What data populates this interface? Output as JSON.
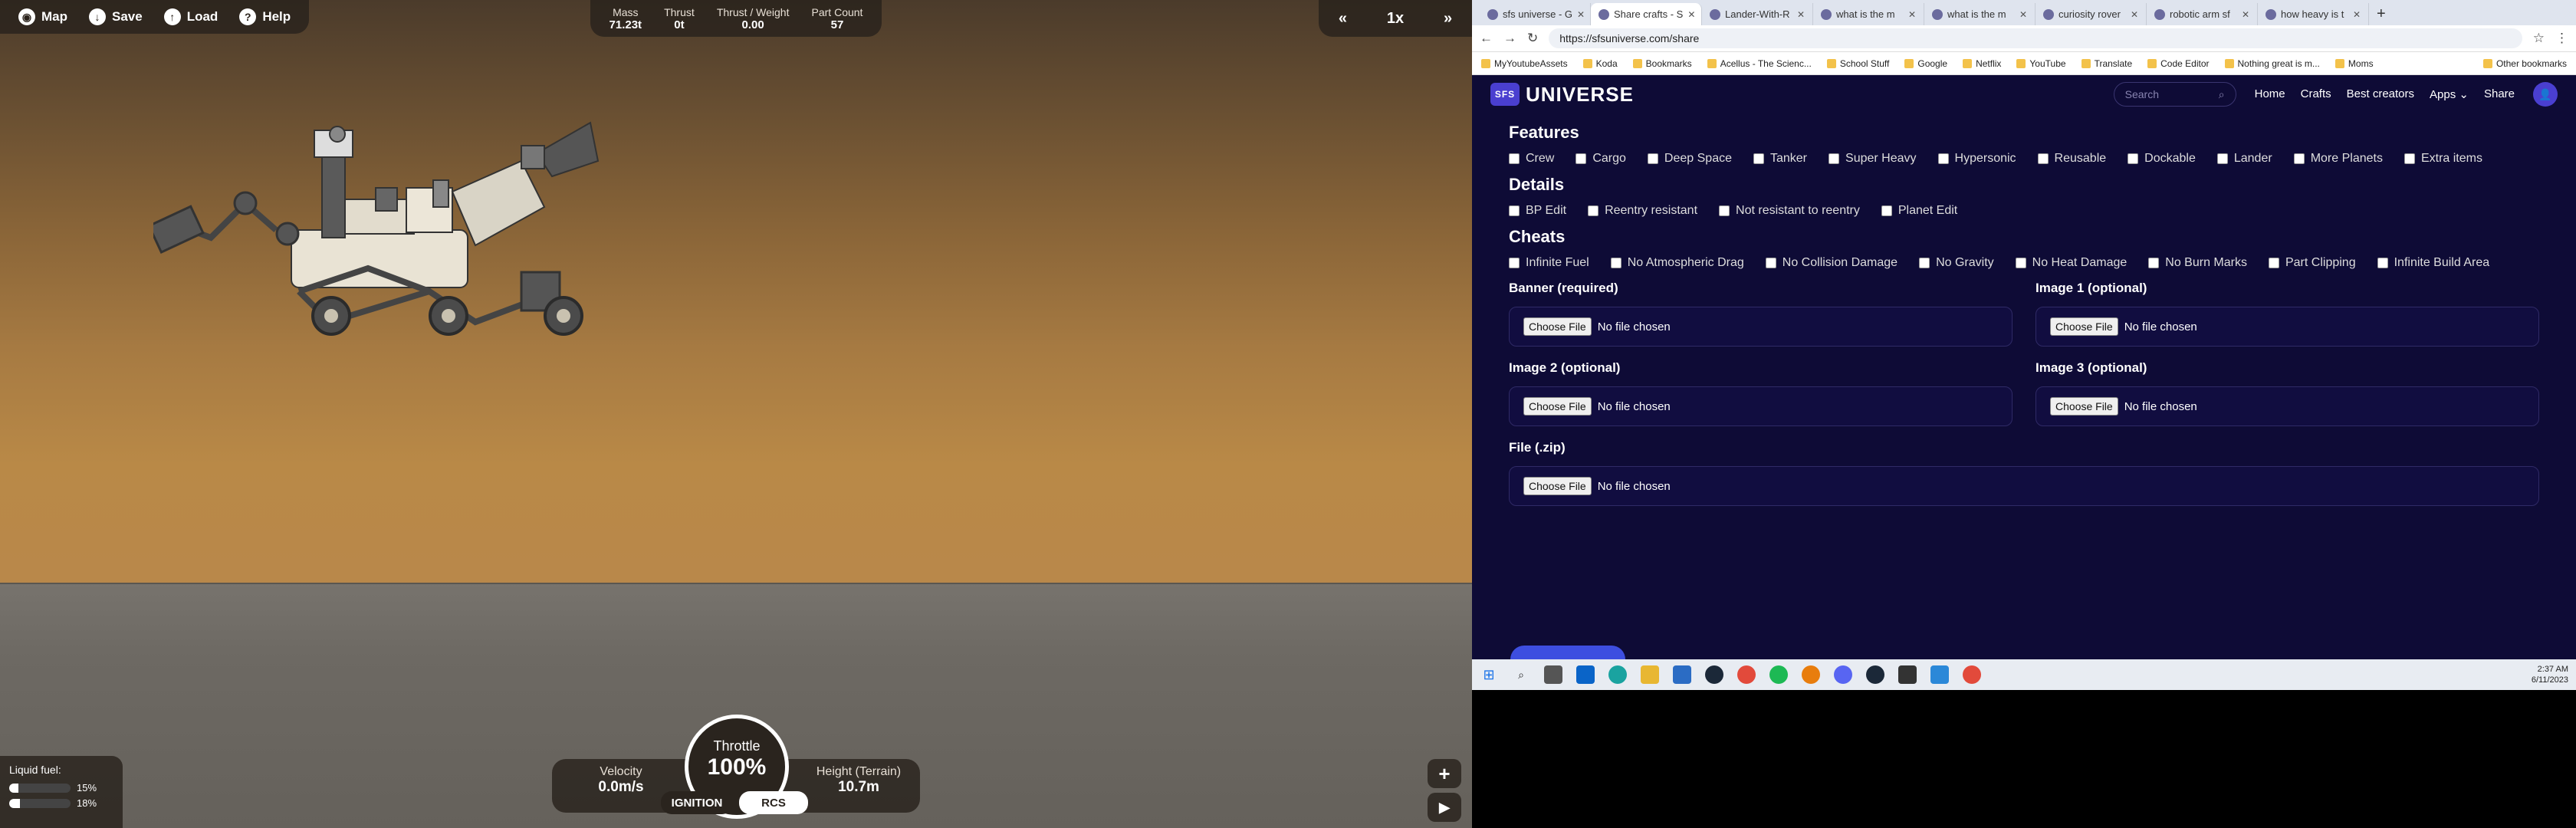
{
  "game": {
    "toolbar": {
      "map": "Map",
      "save": "Save",
      "load": "Load",
      "help": "Help"
    },
    "stats": [
      {
        "k": "Mass",
        "v": "71.23t"
      },
      {
        "k": "Thrust",
        "v": "0t"
      },
      {
        "k": "Thrust / Weight",
        "v": "0.00"
      },
      {
        "k": "Part Count",
        "v": "57"
      }
    ],
    "time": {
      "slow": "«",
      "speed": "1x",
      "fast": "»"
    },
    "fuel": {
      "title": "Liquid fuel:",
      "r1": "15%",
      "r2": "18%",
      "r1v": 0.15,
      "r2v": 0.18
    },
    "velocity": {
      "k": "Velocity",
      "v": "0.0m/s"
    },
    "height": {
      "k": "Height (Terrain)",
      "v": "10.7m"
    },
    "throttle": {
      "k": "Throttle",
      "v": "100%"
    },
    "ignition": "IGNITION",
    "rcs": "RCS",
    "zoom_plus": "+",
    "play": "▶"
  },
  "browser": {
    "tabs": [
      "sfs universe - G",
      "Share crafts - S",
      "Lander-With-R",
      "what is the m",
      "what is the m",
      "curiosity rover",
      "robotic arm sf",
      "how heavy is t"
    ],
    "url": "https://sfsuniverse.com/share",
    "bookmarks": [
      "MyYoutubeAssets",
      "Koda",
      "Bookmarks",
      "Acellus - The Scienc...",
      "School Stuff",
      "Google",
      "Netflix",
      "YouTube",
      "Translate",
      "Code Editor",
      "Nothing great is m...",
      "Moms"
    ],
    "other_bookmarks": "Other bookmarks",
    "site": {
      "logo_text": "UNIVERSE",
      "logo_badge": "SFS",
      "search_placeholder": "Search",
      "nav": [
        "Home",
        "Crafts",
        "Best creators",
        "Apps ⌄",
        "Share"
      ]
    },
    "features": {
      "title": "Features",
      "items": [
        "Crew",
        "Cargo",
        "Deep Space",
        "Tanker",
        "Super Heavy",
        "Hypersonic",
        "Reusable",
        "Dockable",
        "Lander",
        "More Planets",
        "Extra items"
      ]
    },
    "details": {
      "title": "Details",
      "items": [
        "BP Edit",
        "Reentry resistant",
        "Not resistant to reentry",
        "Planet Edit"
      ]
    },
    "cheats": {
      "title": "Cheats",
      "items": [
        "Infinite Fuel",
        "No Atmospheric Drag",
        "No Collision Damage",
        "No Gravity",
        "No Heat Damage",
        "No Burn Marks",
        "Part Clipping",
        "Infinite Build Area"
      ]
    },
    "uploads": [
      {
        "label": "Banner (required)"
      },
      {
        "label": "Image 1 (optional)"
      },
      {
        "label": "Image 2 (optional)"
      },
      {
        "label": "Image 3 (optional)"
      }
    ],
    "zip": {
      "label": "File (.zip)"
    },
    "choose": "Choose File",
    "nofile": "No file chosen"
  },
  "taskbar": {
    "time": "2:37 AM",
    "date": "6/11/2023"
  }
}
